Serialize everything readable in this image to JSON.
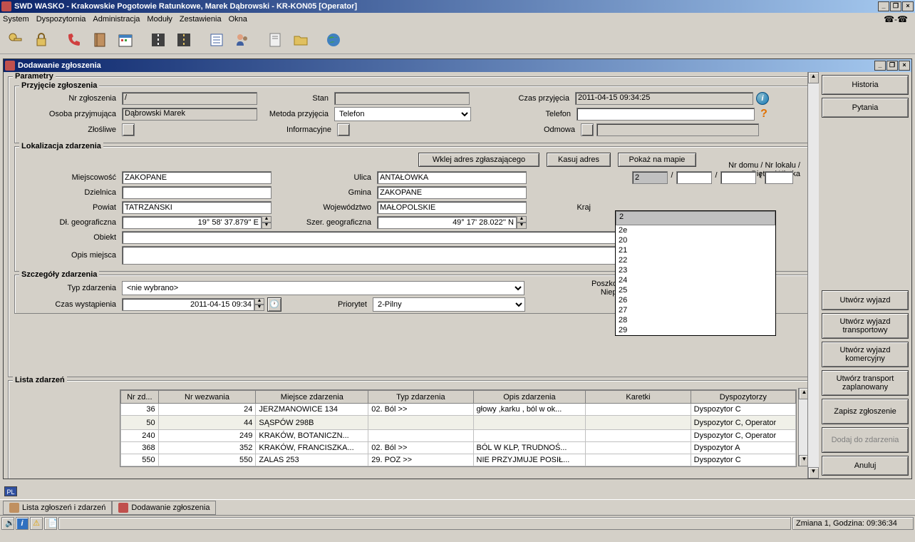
{
  "app": {
    "title": "SWD WASKO - Krakowskie Pogotowie Ratunkowe, Marek Dąbrowski - KR-KON05 [Operator]",
    "minimize": "_",
    "restore": "❐",
    "close": "×"
  },
  "menu": {
    "system": "System",
    "dyspozytornia": "Dyspozytornia",
    "administracja": "Administracja",
    "moduly": "Moduły",
    "zestawienia": "Zestawienia",
    "okna": "Okna",
    "phone_icons": "☎-☎"
  },
  "mdi": {
    "title": "Dodawanie zgłoszenia"
  },
  "rightButtons": {
    "historia": "Historia",
    "pytania": "Pytania",
    "utworz_wyjazd": "Utwórz wyjazd",
    "utworz_wyjazd_trans": "Utwórz wyjazd transportowy",
    "utworz_wyjazd_kom": "Utwórz wyjazd komercyjny",
    "utworz_transport": "Utwórz transport zaplanowany",
    "zapisz": "Zapisz zgłoszenie",
    "dodaj": "Dodaj do zdarzenia",
    "anuluj": "Anuluj"
  },
  "groups": {
    "parametry": "Parametry",
    "przyjecie": "Przyjęcie zgłoszenia",
    "lokalizacja": "Lokalizacja zdarzenia",
    "szczegoly": "Szczegóły zdarzenia",
    "lista": "Lista zdarzeń"
  },
  "przyjecie": {
    "nr_zgloszenia_lbl": "Nr zgłoszenia",
    "nr_zgloszenia_val": "                        /",
    "osoba_lbl": "Osoba przyjmująca",
    "osoba_val": "Dąbrowski Marek",
    "zlosliwe_lbl": "Złośliwe",
    "stan_lbl": "Stan",
    "stan_val": "",
    "metoda_lbl": "Metoda przyjęcia",
    "metoda_val": "Telefon",
    "informacyjne_lbl": "Informacyjne",
    "czas_lbl": "Czas przyjęcia",
    "czas_val": "2011-04-15 09:34:25",
    "telefon_lbl": "Telefon",
    "telefon_val": "",
    "odmowa_lbl": "Odmowa",
    "odmowa_val": ""
  },
  "lok": {
    "btn_wklej": "Wklej adres zgłaszającego",
    "btn_kasuj": "Kasuj adres",
    "btn_pokaz": "Pokaż na mapie",
    "miejscowosc_lbl": "Miejscowość",
    "miejscowosc_val": "ZAKOPANE",
    "dzielnica_lbl": "Dzielnica",
    "dzielnica_val": "",
    "powiat_lbl": "Powiat",
    "powiat_val": "TATRZAŃSKI",
    "dl_geo_lbl": "Dł. geograficzna",
    "dl_geo_val": "19° 58' 37.879'' E",
    "obiekt_lbl": "Obiekt",
    "obiekt_val": "",
    "opis_lbl": "Opis miejsca",
    "opis_val": "",
    "ulica_lbl": "Ulica",
    "ulica_val": "ANTAŁÓWKA",
    "gmina_lbl": "Gmina",
    "gmina_val": "ZAKOPANE",
    "woj_lbl": "Województwo",
    "woj_val": "MAŁOPOLSKIE",
    "sz_geo_lbl": "Szer. geograficzna",
    "sz_geo_val": "49° 17' 28.022'' N",
    "nrdomu_lbl1": "Nr domu / Nr lokalu /",
    "nrdomu_lbl2": "Piętro / Klatka",
    "nrdomu_val": "2",
    "kraj_lbl": "Kraj"
  },
  "dropdown_items": [
    "2",
    "2e",
    "20",
    "21",
    "22",
    "23",
    "24",
    "25",
    "26",
    "27",
    "28",
    "29"
  ],
  "szcz": {
    "typ_lbl": "Typ zdarzenia",
    "typ_val": "<nie wybrano>",
    "czas_lbl": "Czas wystąpienia",
    "czas_val": "2011-04-15 09:34",
    "priorytet_lbl": "Priorytet",
    "priorytet_val": "2-Pilny",
    "poszk_lbl1": "Poszkodowani /",
    "poszk_lbl2": "Nieprzytomni"
  },
  "table": {
    "headers": [
      "Nr zd...",
      "Nr wezwania",
      "Miejsce zdarzenia",
      "Typ zdarzenia",
      "Opis zdarzenia",
      "Karetki",
      "Dyspozytorzy"
    ],
    "rows": [
      {
        "nr": "36",
        "wez": "24",
        "miejsce": "JERZMANOWICE 134",
        "typ": "02.  Ból >>",
        "opis": "głowy ,karku , ból w ok...",
        "kar": "",
        "dys": "Dyspozytor C"
      },
      {
        "nr": "50",
        "wez": "44",
        "miejsce": "SĄSPÓW 298B",
        "typ": "",
        "opis": "",
        "kar": "",
        "dys": "Dyspozytor C, Operator"
      },
      {
        "nr": "240",
        "wez": "249",
        "miejsce": "KRAKÓW, BOTANICZN...",
        "typ": "",
        "opis": "",
        "kar": "",
        "dys": "Dyspozytor C, Operator"
      },
      {
        "nr": "368",
        "wez": "352",
        "miejsce": "KRAKÓW, FRANCISZKA...",
        "typ": "02.  Ból >>",
        "opis": "BÓL W KLP, TRUDNOŚ...",
        "kar": "",
        "dys": "Dyspozytor A"
      },
      {
        "nr": "550",
        "wez": "550",
        "miejsce": "ZALAS 253",
        "typ": "29.  POZ >>",
        "opis": "NIE PRZYJMUJE POSIŁ...",
        "kar": "",
        "dys": "Dyspozytor C"
      }
    ]
  },
  "pl": "PL",
  "tabs": {
    "lista": "Lista zgłoszeń i zdarzeń",
    "dodawanie": "Dodawanie zgłoszenia"
  },
  "status": {
    "zmiana": "Zmiana 1, Godzina: 09:36:34"
  }
}
